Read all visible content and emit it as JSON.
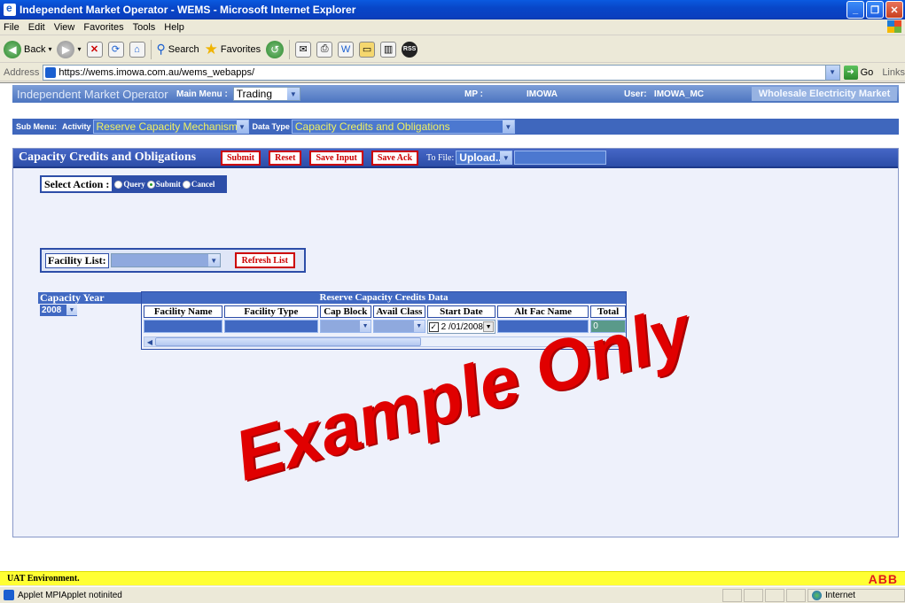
{
  "window": {
    "title": "Independent Market Operator - WEMS - Microsoft Internet Explorer"
  },
  "menu": [
    "File",
    "Edit",
    "View",
    "Favorites",
    "Tools",
    "Help"
  ],
  "toolbar": {
    "back": "Back",
    "search": "Search",
    "favorites": "Favorites"
  },
  "address": {
    "label": "Address",
    "url": "https://wems.imowa.com.au/wems_webapps/",
    "go": "Go",
    "links": "Links"
  },
  "header": {
    "brand": "Independent Market Operator",
    "main_menu_label": "Main Menu :",
    "main_menu_value": "Trading",
    "mp_label": "MP :",
    "mp_value": "IMOWA",
    "user_label": "User:",
    "user_value": "IMOWA_MC",
    "wem": "Wholesale Electricity Market"
  },
  "submenu": {
    "label": "Sub Menu:",
    "activity_label": "Activity",
    "activity_value": "Reserve Capacity Mechanism",
    "data_type_label": "Data Type",
    "data_type_value": "Capacity Credits and Obligations"
  },
  "panel": {
    "title": "Capacity Credits and Obligations",
    "buttons": {
      "submit": "Submit",
      "reset": "Reset",
      "save_input": "Save Input",
      "save_ack": "Save Ack"
    },
    "to_file": "To File:",
    "upload": "Upload..."
  },
  "action": {
    "label": "Select Action :",
    "options": [
      "Query",
      "Submit",
      "Cancel"
    ],
    "selected": "Submit"
  },
  "facility": {
    "label": "Facility List:",
    "refresh": "Refresh List"
  },
  "capacity_year": {
    "label": "Capacity Year",
    "value": "2008"
  },
  "grid": {
    "title": "Reserve Capacity Credits Data",
    "columns": [
      "Facility Name",
      "Facility Type",
      "Cap Block",
      "Avail Class",
      "Start Date",
      "Alt Fac Name",
      "Total"
    ],
    "row": {
      "start_date": "2 /01/2008",
      "total": "0"
    }
  },
  "watermark": "Example Only",
  "footer": {
    "env": "UAT Environment.",
    "logo": "ABB"
  },
  "status": {
    "text": "Applet MPIApplet notinited",
    "zone": "Internet"
  }
}
